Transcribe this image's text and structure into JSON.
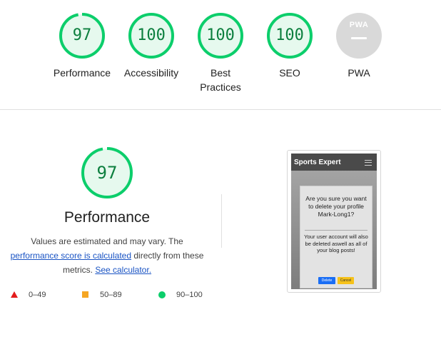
{
  "categories": [
    {
      "label": "Performance",
      "score": "97",
      "value": 97
    },
    {
      "label": "Accessibility",
      "score": "100",
      "value": 100
    },
    {
      "label": "Best Practices",
      "score": "100",
      "value": 100
    },
    {
      "label": "SEO",
      "score": "100",
      "value": 100
    },
    {
      "label": "PWA",
      "score": "",
      "value": null
    }
  ],
  "pwa_badge": "PWA",
  "performance": {
    "score": "97",
    "value": 97,
    "title": "Performance",
    "desc_line1": "Values are estimated and may vary. The",
    "link_score": "performance score is calculated",
    "desc_mid": "directly from these",
    "desc_metrics": "metrics.",
    "link_calculator": "See calculator."
  },
  "legend": [
    {
      "range": "0–49",
      "color": "#e31c1c"
    },
    {
      "range": "50–89",
      "color": "#f5a623"
    },
    {
      "range": "90–100",
      "color": "#0cce6b"
    }
  ],
  "screenshot": {
    "brand": "Sports Expert",
    "question": "Are you sure you want to delete your profile Mark-Long1?",
    "message": "Your user account will also be deleted aswell as all of your blog posts!",
    "delete_label": "Delete",
    "cancel_label": "Cancel"
  },
  "colors": {
    "pass": "#0cce6b",
    "pass_text": "#0c7f3e",
    "pass_fill": "#e6f9ee",
    "na": "#d9d9d9"
  }
}
